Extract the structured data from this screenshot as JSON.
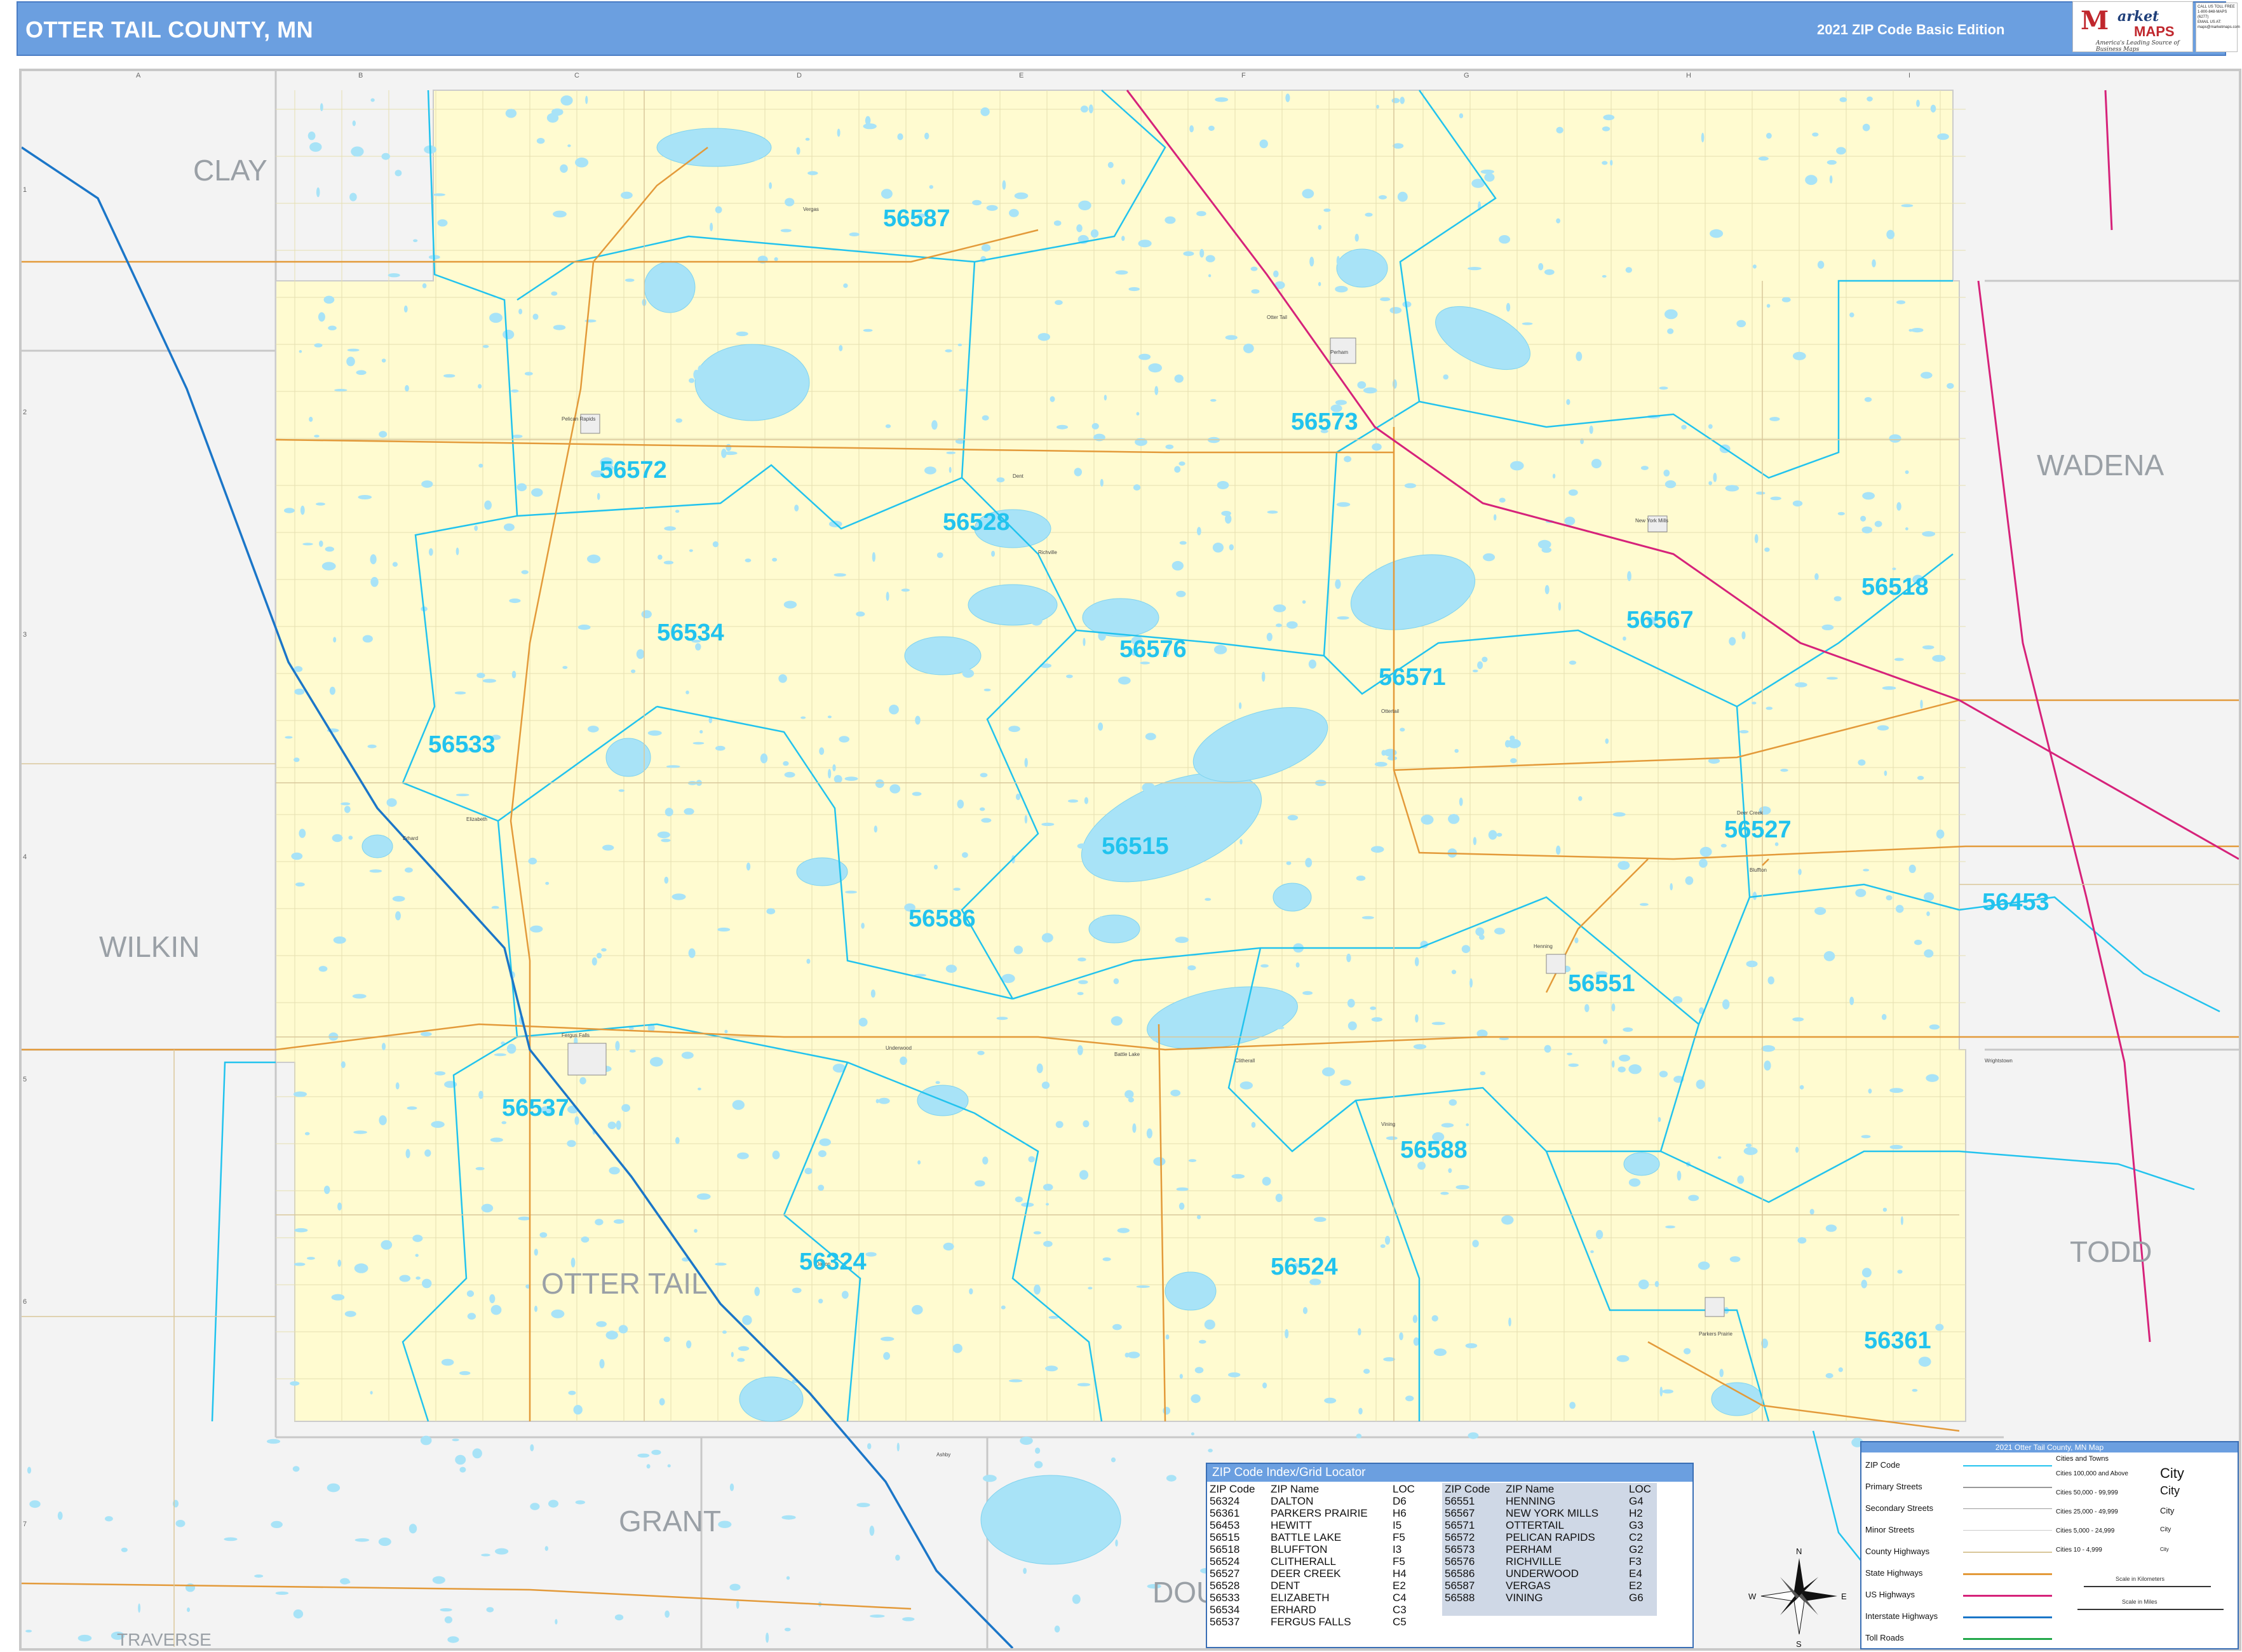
{
  "header": {
    "title": "OTTER TAIL COUNTY, MN",
    "edition": "2021 ZIP Code Basic Edition",
    "logo_mark": "M",
    "logo_word1": "arket",
    "logo_word2": "MAPS",
    "logo_tagline": "America's Leading Source of Business Maps",
    "contact_lines": [
      "CALL US TOLL FREE",
      "1-800-848-MAPS (6277)",
      "EMAIL US AT:",
      "maps@marketmaps.com"
    ]
  },
  "colors": {
    "header_bg": "#6b9fe0",
    "county_fill": "#fffbd0",
    "surrounding_fill": "#f3f3f3",
    "water": "#a8e3f7",
    "zip_boundary": "#22c3ee",
    "zip_label": "#22c3ee",
    "state_highway": "#e39a3a",
    "us_highway": "#d6227a",
    "interstate": "#1b76c8",
    "county_line": "#c0c0c0"
  },
  "grid": {
    "columns": [
      "A",
      "B",
      "C",
      "D",
      "E",
      "F",
      "G",
      "H",
      "I"
    ],
    "rows": [
      "1",
      "2",
      "3",
      "4",
      "5",
      "6",
      "7"
    ]
  },
  "map": {
    "counties": [
      {
        "name": "CLAY"
      },
      {
        "name": "WADENA"
      },
      {
        "name": "WILKIN"
      },
      {
        "name": "TODD"
      },
      {
        "name": "OTTER TAIL"
      },
      {
        "name": "GRANT"
      },
      {
        "name": "DOU"
      },
      {
        "name": "TRAVERSE"
      }
    ],
    "zip_labels": [
      "56587",
      "56573",
      "56572",
      "56528",
      "56518",
      "56567",
      "56534",
      "56576",
      "56571",
      "56533",
      "56515",
      "56527",
      "56453",
      "56586",
      "56551",
      "56537",
      "56588",
      "56324",
      "56524",
      "56361"
    ],
    "towns": [
      "Pelican Rapids",
      "Dent",
      "Richville",
      "Perham",
      "Ottertail",
      "New York Mills",
      "Vergas",
      "Otter Tail",
      "Erhard",
      "Elizabeth",
      "Fergus Falls",
      "Underwood",
      "Battle Lake",
      "Clitherall",
      "Henning",
      "Parkers Prairie",
      "Dalton",
      "Deer Creek",
      "Bluffton",
      "Wrightstown",
      "Ashby",
      "Vining"
    ]
  },
  "zip_index": {
    "title": "ZIP Code Index/Grid Locator",
    "columns": [
      "ZIP Code",
      "ZIP Name",
      "LOC"
    ],
    "left_rows": [
      [
        "56324",
        "DALTON",
        "D6"
      ],
      [
        "56361",
        "PARKERS PRAIRIE",
        "H6"
      ],
      [
        "56453",
        "HEWITT",
        "I5"
      ],
      [
        "56515",
        "BATTLE LAKE",
        "F5"
      ],
      [
        "56518",
        "BLUFFTON",
        "I3"
      ],
      [
        "56524",
        "CLITHERALL",
        "F5"
      ],
      [
        "56527",
        "DEER CREEK",
        "H4"
      ],
      [
        "56528",
        "DENT",
        "E2"
      ],
      [
        "56533",
        "ELIZABETH",
        "C4"
      ],
      [
        "56534",
        "ERHARD",
        "C3"
      ],
      [
        "56537",
        "FERGUS FALLS",
        "C5"
      ]
    ],
    "right_rows": [
      [
        "56551",
        "HENNING",
        "G4"
      ],
      [
        "56567",
        "NEW YORK MILLS",
        "H2"
      ],
      [
        "56571",
        "OTTERTAIL",
        "G3"
      ],
      [
        "56572",
        "PELICAN RAPIDS",
        "C2"
      ],
      [
        "56573",
        "PERHAM",
        "G2"
      ],
      [
        "56576",
        "RICHVILLE",
        "F3"
      ],
      [
        "56586",
        "UNDERWOOD",
        "E4"
      ],
      [
        "56587",
        "VERGAS",
        "E2"
      ],
      [
        "56588",
        "VINING",
        "G6"
      ]
    ]
  },
  "legend": {
    "title": "2021 Otter Tail County, MN Map",
    "items": [
      "ZIP Code",
      "Primary Streets",
      "Secondary Streets",
      "Minor Streets",
      "County Highways",
      "State Highways",
      "US Highways",
      "Interstate Highways",
      "Toll Roads"
    ],
    "cities_heading": "Cities and Towns",
    "city_classes": [
      {
        "range": "Cities 100,000 and Above",
        "sample": "City"
      },
      {
        "range": "Cities 50,000 - 99,999",
        "sample": "City"
      },
      {
        "range": "Cities 25,000 - 49,999",
        "sample": "City"
      },
      {
        "range": "Cities 5,000 - 24,999",
        "sample": "City"
      },
      {
        "range": "Cities 10 - 4,999",
        "sample": "City"
      }
    ],
    "scale_km": "Scale in Kilometers",
    "scale_mi": "Scale in Miles",
    "compass": [
      "N",
      "S",
      "E",
      "W"
    ]
  }
}
